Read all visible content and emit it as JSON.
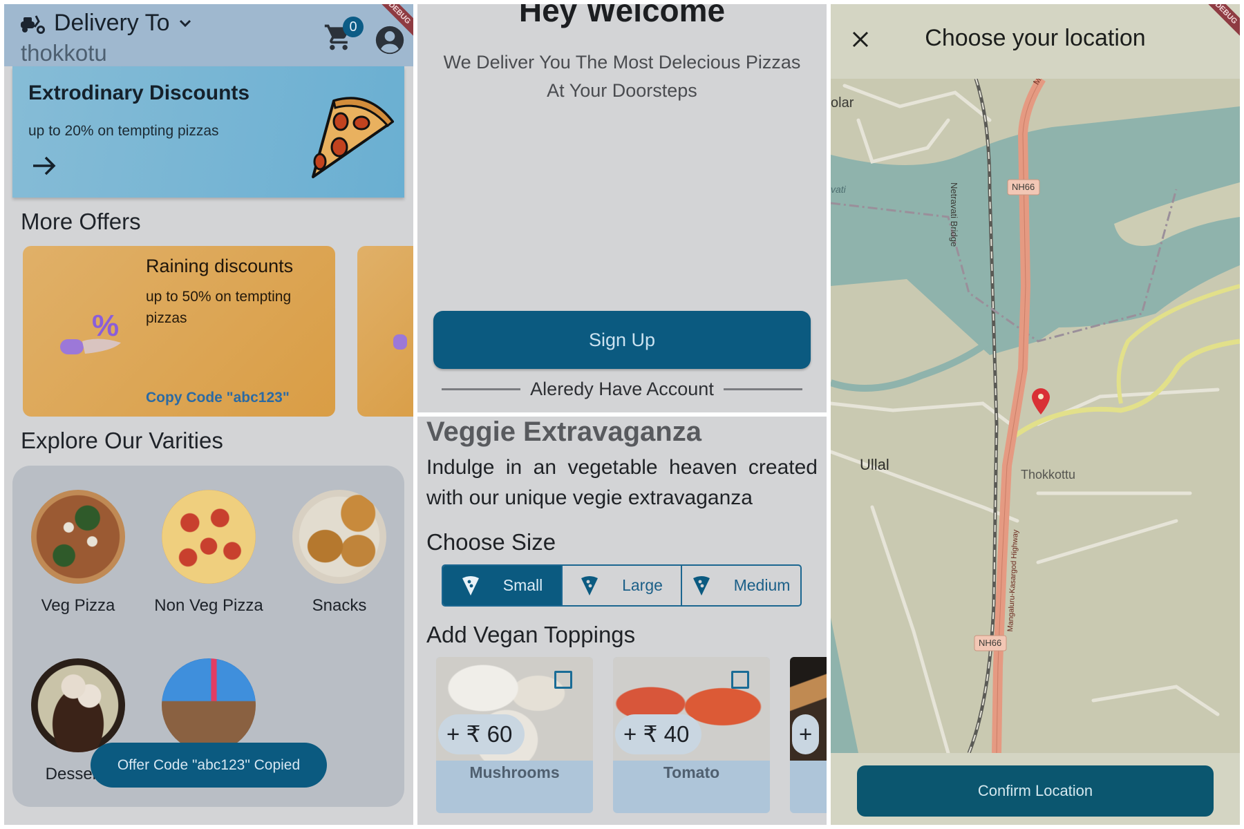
{
  "home": {
    "header": {
      "delivery_title": "Delivery To",
      "location": "thokkotu",
      "cart_count": "0",
      "debug_ribbon": "DEBUG"
    },
    "banner": {
      "title": "Extrodinary Discounts",
      "subtitle": "up to 20% on tempting pizzas"
    },
    "more_offers": {
      "title": "More Offers",
      "cards": [
        {
          "title": "Raining discounts",
          "subtitle": "up to 50% on tempting pizzas",
          "code_label": "Copy Code \"abc123\""
        }
      ]
    },
    "varieties": {
      "title": "Explore Our Varities",
      "items": [
        {
          "label": "Veg Pizza"
        },
        {
          "label": "Non Veg Pizza"
        },
        {
          "label": "Snacks"
        },
        {
          "label": "Desserts"
        },
        {
          "label": ""
        }
      ]
    },
    "snackbar": "Offer Code \"abc123\" Copied"
  },
  "welcome": {
    "title": "Hey Welcome",
    "subtitle_line1": "We Deliver You The Most Delecious Pizzas",
    "subtitle_line2": "At Your Doorsteps",
    "signup_label": "Sign Up",
    "already_label": "Aleredy Have Account"
  },
  "pizza_detail": {
    "title": "Veggie Extravaganza",
    "description": "Indulge in an vegetable heaven created with our unique vegie extravaganza",
    "size_title": "Choose Size",
    "sizes": [
      {
        "label": "Small",
        "selected": true
      },
      {
        "label": "Large",
        "selected": false
      },
      {
        "label": "Medium",
        "selected": false
      }
    ],
    "toppings_title": "Add Vegan Toppings",
    "toppings": [
      {
        "name": "Mushrooms",
        "price": "+ ₹ 60",
        "checked": false
      },
      {
        "name": "Tomato",
        "price": "+ ₹ 40",
        "checked": false
      },
      {
        "name": "",
        "price": "+",
        "checked": false
      }
    ]
  },
  "location": {
    "title": "Choose your location",
    "confirm_label": "Confirm Location",
    "map_labels": {
      "kotekar": "olar",
      "river": "vati",
      "bridge": "Netravati Bridge",
      "nh66_a": "NH66",
      "nh66_b": "NH66",
      "highway": "Mangaluru-Kasargod Highway",
      "ullal": "Ullal",
      "thokkottu": "Thokkottu",
      "mang": "Mang"
    }
  },
  "colors": {
    "primary": "#0b5a80",
    "header_bg": "#9fb8cf",
    "offer_bg": "#dda555",
    "marker": "#d93036",
    "highway": "#e39a80"
  }
}
